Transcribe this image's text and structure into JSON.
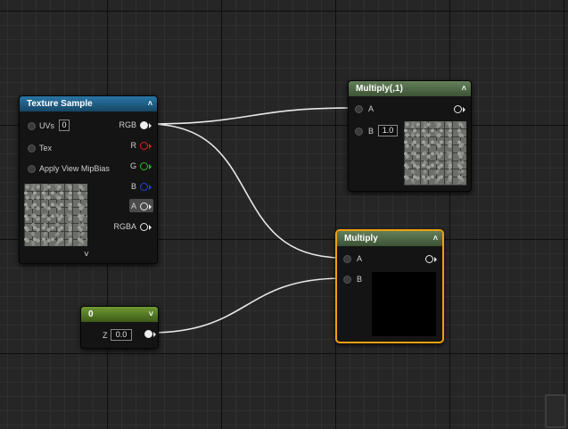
{
  "nodes": {
    "texture_sample": {
      "title": "Texture Sample",
      "header_color": "#1f5c82",
      "inputs": {
        "uvs": "UVs",
        "uvs_value": "0",
        "tex": "Tex",
        "mipbias": "Apply View MipBias"
      },
      "outputs": {
        "rgb": "RGB",
        "r": "R",
        "g": "G",
        "b": "B",
        "a": "A",
        "rgba": "RGBA"
      },
      "collapse_icon": "chevron-down-icon"
    },
    "multiply1": {
      "title": "Multiply(,1)",
      "header_color": "#4f6a48",
      "pin_a": "A",
      "pin_b": "B",
      "b_value": "1.0"
    },
    "multiply": {
      "title": "Multiply",
      "header_color": "#4f6a48",
      "border_color": "#f0a010",
      "pin_a": "A",
      "pin_b": "B"
    },
    "constant": {
      "title": "0",
      "header_color": "#4f7a22",
      "output_label": "Z",
      "value": "0.0"
    }
  },
  "colors": {
    "r_pin": "#e02020",
    "g_pin": "#20c020",
    "b_pin": "#2040e0",
    "wire": "#e8e8e8"
  }
}
